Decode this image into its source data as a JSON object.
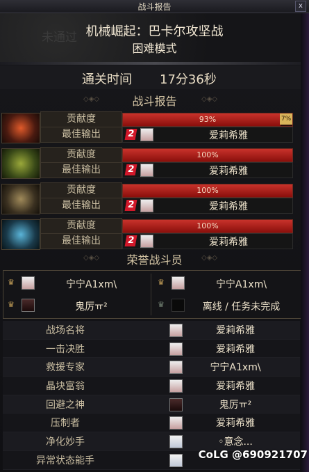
{
  "window": {
    "title": "战斗报告",
    "close_label": "x"
  },
  "dungeon": {
    "stamp": "未通过",
    "name": "机械崛起：巴卡尔攻坚战",
    "mode": "困难模式"
  },
  "clear_time": {
    "label": "通关时间",
    "value": "17分36秒"
  },
  "battle_report_heading": "战斗报告",
  "boss_rows": [
    {
      "contribution_label": "贡献度",
      "percent": 93,
      "percent_text": "93%",
      "secondary_text": "7%",
      "top_dps_label": "最佳输出",
      "top_player": "爱莉希雅",
      "badge": "2"
    },
    {
      "contribution_label": "贡献度",
      "percent": 100,
      "percent_text": "100%",
      "secondary_text": "",
      "top_dps_label": "最佳输出",
      "top_player": "爱莉希雅",
      "badge": "2"
    },
    {
      "contribution_label": "贡献度",
      "percent": 100,
      "percent_text": "100%",
      "secondary_text": "",
      "top_dps_label": "最佳输出",
      "top_player": "爱莉希雅",
      "badge": "2"
    },
    {
      "contribution_label": "贡献度",
      "percent": 100,
      "percent_text": "100%",
      "secondary_text": "",
      "top_dps_label": "最佳输出",
      "top_player": "爱莉希雅",
      "badge": "2"
    }
  ],
  "honor_heading": "荣誉战斗员",
  "honor_members": [
    {
      "name": "宁宁A1xm\\"
    },
    {
      "name": "宁宁A1xm\\"
    },
    {
      "name": "鬼厉ㅠ²"
    },
    {
      "name": "离线 / 任务未完成"
    }
  ],
  "awards": [
    {
      "title": "战场名将",
      "player": "爱莉希雅"
    },
    {
      "title": "一击决胜",
      "player": "爱莉希雅"
    },
    {
      "title": "救援专家",
      "player": "宁宁A1xm\\"
    },
    {
      "title": "晶块富翁",
      "player": "爱莉希雅"
    },
    {
      "title": "回避之神",
      "player": "鬼厉ㅠ²"
    },
    {
      "title": "压制者",
      "player": "爱莉希雅"
    },
    {
      "title": "净化妙手",
      "player": "◦意念..."
    },
    {
      "title": "异常状态能手",
      "player": ""
    }
  ],
  "watermark": "CoLG @690921707",
  "colors": {
    "bar_red": "#c8322b",
    "badge_red": "#d2182a",
    "gold": "#c8a35a"
  }
}
